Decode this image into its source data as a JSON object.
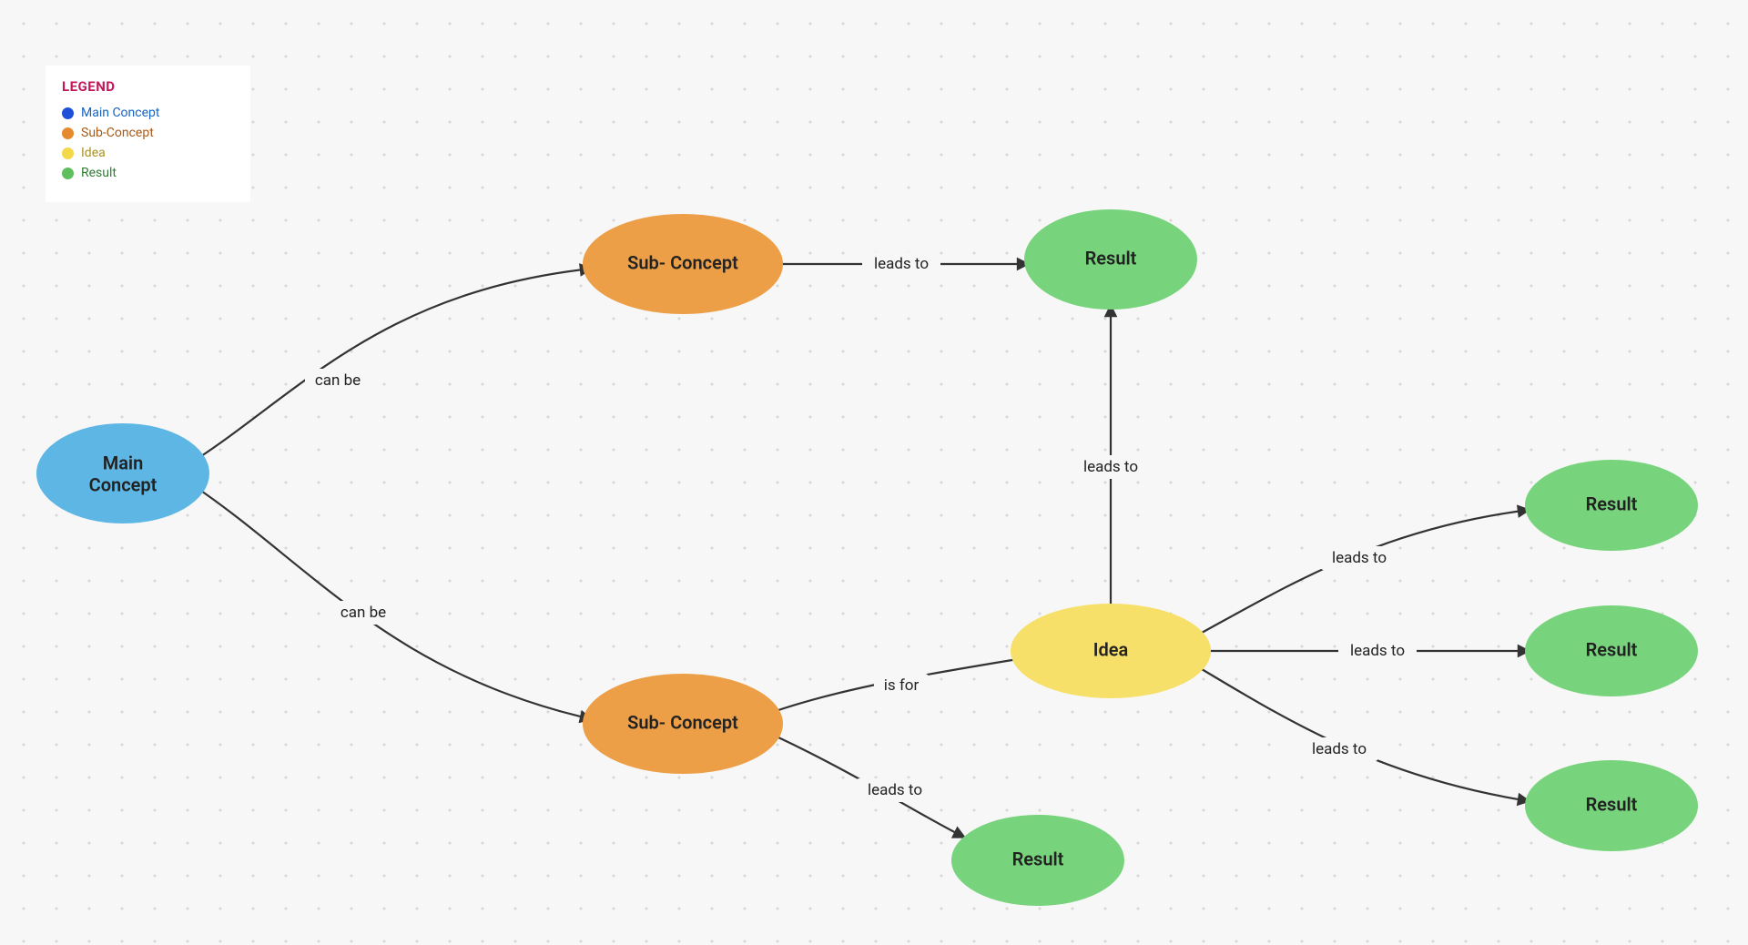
{
  "legend": {
    "title": "LEGEND",
    "items": [
      {
        "label": "Main Concept",
        "color": "#1e4fd8"
      },
      {
        "label": "Sub-Concept",
        "color": "#e58a2e"
      },
      {
        "label": "Idea",
        "color": "#f3d94a"
      },
      {
        "label": "Result",
        "color": "#5fbf5f"
      }
    ]
  },
  "nodes": {
    "main": {
      "label_line1": "Main",
      "label_line2": "Concept"
    },
    "sub_top": {
      "label": "Sub- Concept"
    },
    "sub_bot": {
      "label": "Sub- Concept"
    },
    "idea": {
      "label": "Idea"
    },
    "result_top": {
      "label": "Result"
    },
    "result_bot": {
      "label": "Result"
    },
    "result_r1": {
      "label": "Result"
    },
    "result_r2": {
      "label": "Result"
    },
    "result_r3": {
      "label": "Result"
    }
  },
  "edges": {
    "main_to_sub_top": {
      "label": "can be"
    },
    "main_to_sub_bot": {
      "label": "can be"
    },
    "sub_top_to_result": {
      "label": "leads to"
    },
    "sub_bot_to_idea": {
      "label": "is for"
    },
    "sub_bot_to_result": {
      "label": "leads to"
    },
    "idea_to_result_top": {
      "label": "leads to"
    },
    "idea_to_r1": {
      "label": "leads to"
    },
    "idea_to_r2": {
      "label": "leads to"
    },
    "idea_to_r3": {
      "label": "leads to"
    }
  },
  "colors": {
    "main": "#5eb6e4",
    "sub": "#ed9f47",
    "idea": "#f6e069",
    "result": "#77d37c",
    "edge": "#333333"
  }
}
